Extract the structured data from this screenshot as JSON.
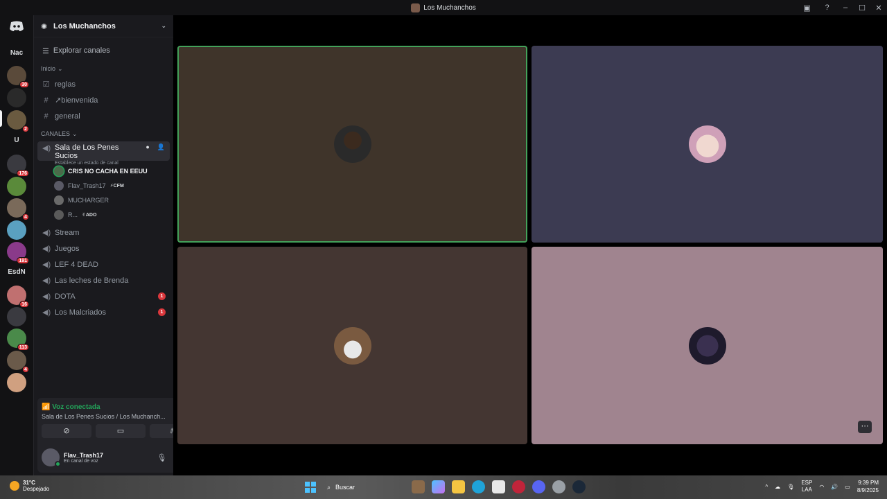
{
  "window": {
    "title": "Los Muchanchos"
  },
  "guilds": [
    {
      "name": "guild-nac",
      "text": "Nac"
    },
    {
      "name": "guild-1",
      "badge": "30"
    },
    {
      "name": "guild-2"
    },
    {
      "name": "guild-3",
      "badge": "2"
    },
    {
      "name": "guild-u",
      "text": "U"
    },
    {
      "name": "guild-4",
      "badge": "176"
    },
    {
      "name": "guild-5"
    },
    {
      "name": "guild-6",
      "badge": "4"
    },
    {
      "name": "guild-7"
    },
    {
      "name": "guild-8",
      "badge": "191"
    },
    {
      "name": "guild-esdn",
      "text": "EsdN"
    },
    {
      "name": "guild-9",
      "badge": "16"
    },
    {
      "name": "guild-10"
    },
    {
      "name": "guild-11",
      "badge": "113"
    },
    {
      "name": "guild-12",
      "badge": "4"
    },
    {
      "name": "guild-13"
    }
  ],
  "server": {
    "name": "Los Muchanchos",
    "explore": "Explorar canales"
  },
  "categories": {
    "home": "Inicio",
    "channels": "CANALES"
  },
  "text_channels": [
    "reglas",
    "↗bienvenida",
    "general"
  ],
  "active_voice": {
    "name": "Sala de Los Penes Sucios",
    "status_hint": "Establece un estado de canal"
  },
  "voice_users": [
    {
      "name": "CRIS NO CACHA EN EEUU",
      "tag": ""
    },
    {
      "name": "Flav_Trash17",
      "tag": "⚡CFM"
    },
    {
      "name": "MUCHARGER",
      "tag": ""
    },
    {
      "name": "R...",
      "tag": "✌ADO"
    }
  ],
  "voice_channels": [
    {
      "name": "Stream",
      "unread": ""
    },
    {
      "name": "Juegos",
      "unread": ""
    },
    {
      "name": "LEF 4 DEAD",
      "unread": ""
    },
    {
      "name": "Las leches de Brenda",
      "unread": ""
    },
    {
      "name": "DOTA",
      "unread": "1"
    },
    {
      "name": "Los Malcriados",
      "unread": "1"
    }
  ],
  "voice_panel": {
    "status": "Voz conectada",
    "location": "Sala de Los Penes Sucios / Los Muchanch..."
  },
  "user": {
    "name": "Flav_Trash17",
    "status": "En canal de voz"
  },
  "tiles_colors": [
    "#3f342a",
    "#3c3b52",
    "#443632",
    "#a0848f"
  ],
  "taskbar": {
    "temp": "31°C",
    "weather": "Despejado",
    "search": "Buscar",
    "lang1": "ESP",
    "lang2": "LAA",
    "time": "9:39 PM",
    "date": "8/9/2025"
  }
}
